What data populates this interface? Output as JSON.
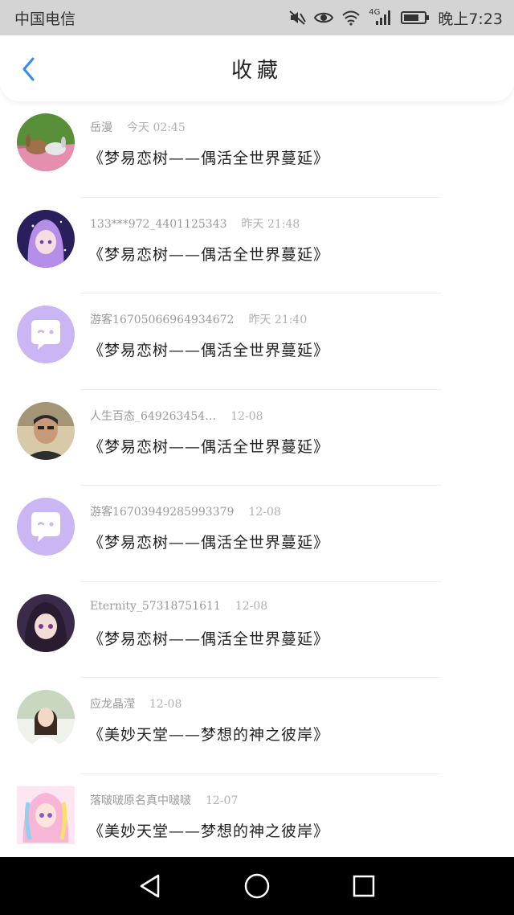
{
  "status_bar": {
    "carrier": "中国电信",
    "network": "4G",
    "time": "晚上7:23",
    "icons": [
      "mute-icon",
      "eye-icon",
      "wifi-icon",
      "signal-icon",
      "battery-icon"
    ]
  },
  "header": {
    "title": "收藏",
    "back_icon": "chevron-left-icon",
    "accent_color": "#2f8cf0"
  },
  "items": [
    {
      "name": "岳漫",
      "time": "今天 02:45",
      "title": "《梦易恋树——偶活全世界蔓延》",
      "avatar": "photo-rabbits"
    },
    {
      "name": "133***972_4401125343",
      "time": "昨天 21:48",
      "title": "《梦易恋树——偶活全世界蔓延》",
      "avatar": "anime-purple-hair"
    },
    {
      "name": "游客16705066964934672",
      "time": "昨天 21:40",
      "title": "《梦易恋树——偶活全世界蔓延》",
      "avatar": "default-chat-bubble"
    },
    {
      "name": "人生百态_649263454…",
      "time": "12-08",
      "title": "《梦易恋树——偶活全世界蔓延》",
      "avatar": "photo-man"
    },
    {
      "name": "游客16703949285993379",
      "time": "12-08",
      "title": "《梦易恋树——偶活全世界蔓延》",
      "avatar": "default-chat-bubble"
    },
    {
      "name": "Eternity_57318751611",
      "time": "12-08",
      "title": "《梦易恋树——偶活全世界蔓延》",
      "avatar": "anime-dark-hair"
    },
    {
      "name": "应龙晶滢",
      "time": "12-08",
      "title": "《美妙天堂——梦想的神之彼岸》",
      "avatar": "photo-girl"
    },
    {
      "name": "落啵啵原名真中啵啵",
      "time": "12-07",
      "title": "《美妙天堂——梦想的神之彼岸》",
      "avatar": "anime-colorful"
    }
  ],
  "nav_bar": {
    "buttons": [
      "back-triangle-icon",
      "home-circle-icon",
      "recents-square-icon"
    ]
  }
}
